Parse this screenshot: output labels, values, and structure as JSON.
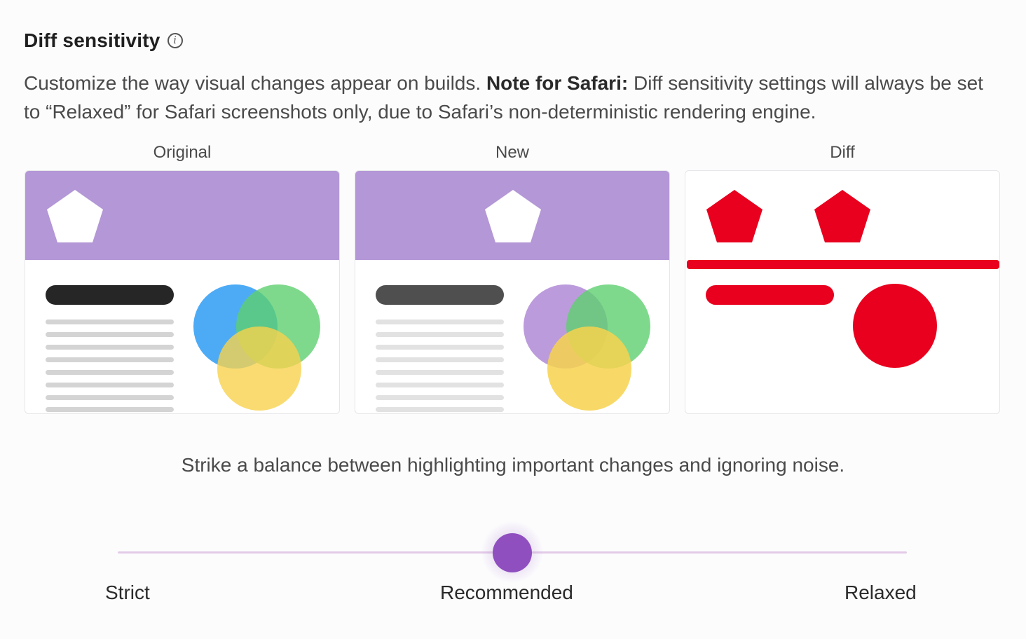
{
  "section": {
    "title": "Diff sensitivity",
    "info_icon": "info-icon",
    "description_part1": "Customize the way visual changes appear on builds. ",
    "description_note_label": "Note for Safari:",
    "description_part2": " Diff sensitivity settings will always be set to “Relaxed” for Safari screenshots only, due to Safari’s non-deterministic rendering engine."
  },
  "panels": [
    {
      "label": "Original"
    },
    {
      "label": "New"
    },
    {
      "label": "Diff"
    }
  ],
  "colors": {
    "header_purple": "#b497d6",
    "diff_red": "#e8001e",
    "thumb_purple": "#8f4fbf",
    "track": "#e3cbe8",
    "circle_blue": "#2e9cf4",
    "circle_green": "#5ecf6f",
    "circle_yellow": "#f7d24e",
    "circle_purple_new": "#b08ad6"
  },
  "tagline": "Strike a balance between highlighting important changes and ignoring noise.",
  "slider": {
    "stops": [
      "Strict",
      "Recommended",
      "Relaxed"
    ],
    "selected": "Recommended",
    "selected_index": 1
  }
}
